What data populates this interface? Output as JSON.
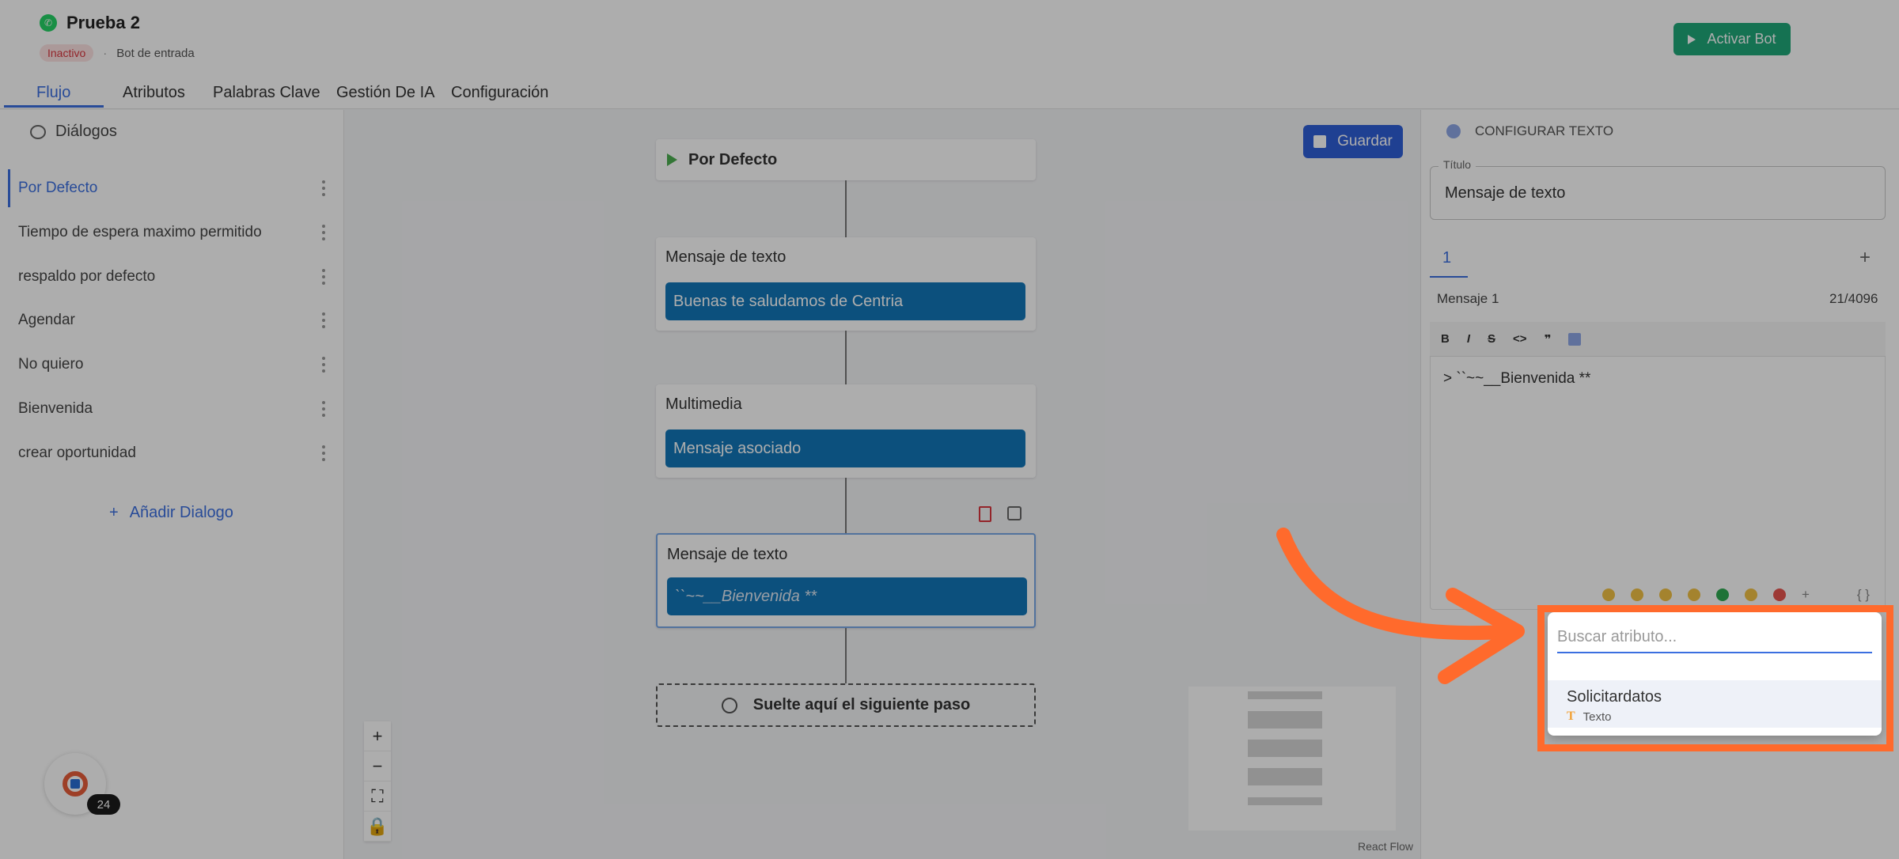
{
  "header": {
    "bot_name": "Prueba 2",
    "status": "Inactivo",
    "separator": "·",
    "bot_type": "Bot de entrada",
    "activate_label": "Activar Bot"
  },
  "tabs": [
    "Flujo",
    "Atributos",
    "Palabras Clave",
    "Gestión De IA",
    "Configuración"
  ],
  "sidebar": {
    "title": "Diálogos",
    "items": [
      "Por Defecto",
      "Tiempo de espera maximo permitido",
      "respaldo por defecto",
      "Agendar",
      "No quiero",
      "Bienvenida",
      "crear oportunidad"
    ],
    "add_label": "Añadir Dialogo"
  },
  "canvas": {
    "save_label": "Guardar",
    "start_node": "Por Defecto",
    "nodes": [
      {
        "title": "Mensaje de texto",
        "content": "Buenas te saludamos de Centria"
      },
      {
        "title": "Multimedia",
        "content": "Mensaje asociado"
      },
      {
        "title": "Mensaje de texto",
        "content": "``~~__Bienvenida **"
      }
    ],
    "drop_zone": "Suelte aquí el siguiente paso",
    "zoom_in": "+",
    "zoom_out": "−",
    "fit": "⛶",
    "lock": "🔒",
    "attribution": "React Flow",
    "badge_count": "24"
  },
  "panel": {
    "header": "CONFIGURAR TEXTO",
    "title_label": "Título",
    "title_value": "Mensaje de texto",
    "message_tab": "1",
    "add_tab": "+",
    "message_label": "Mensaje 1",
    "char_count": "21/4096",
    "toolbar": [
      "B",
      "I",
      "S",
      "<>",
      "❞"
    ],
    "editor_text": "> ``~~__Bienvenida **",
    "footer_plus": "+",
    "footer_braces": "{ }"
  },
  "dropdown": {
    "search_placeholder": "Buscar atributo...",
    "items": [
      {
        "name": "Solicitardatos",
        "type": "Texto",
        "type_icon": "T"
      }
    ]
  },
  "colors": {
    "accent": "#3b6fe0",
    "node_fill": "#1277b8",
    "activate": "#1fa87a",
    "highlight": "#ff6a2c"
  }
}
